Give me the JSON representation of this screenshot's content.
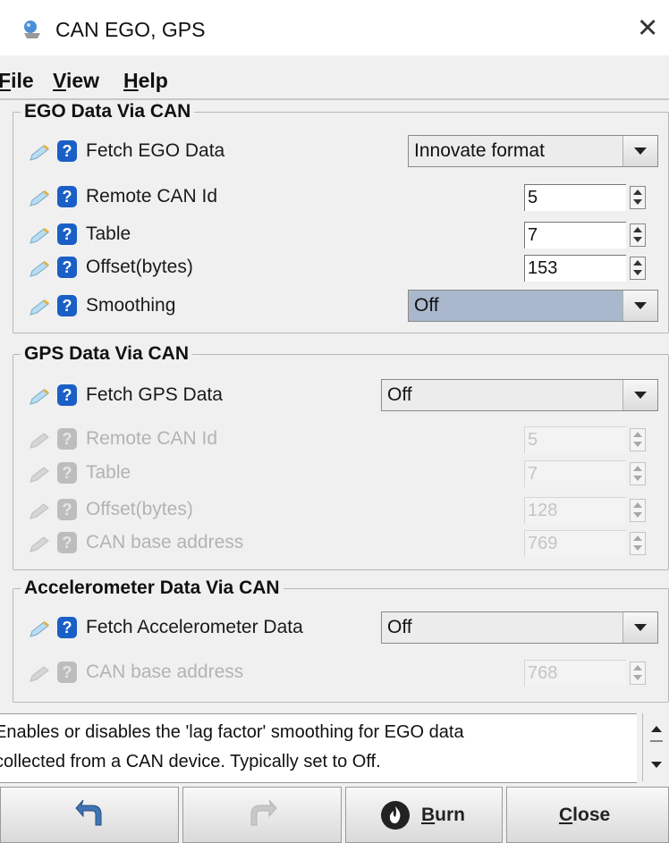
{
  "window": {
    "title": "CAN EGO, GPS"
  },
  "menu": {
    "file": {
      "first": "F",
      "rest": "ile"
    },
    "view": {
      "first": "V",
      "rest": "iew"
    },
    "help": {
      "first": "H",
      "rest": "elp"
    }
  },
  "ego_group": {
    "title": "EGO Data Via CAN",
    "fetch": {
      "label": "Fetch EGO Data",
      "value": "Innovate format"
    },
    "remote_can_id": {
      "label": "Remote CAN Id",
      "value": "5"
    },
    "table": {
      "label": "Table",
      "value": "7"
    },
    "offset": {
      "label": "Offset(bytes)",
      "value": "153"
    },
    "smoothing": {
      "label": "Smoothing",
      "value": "Off"
    }
  },
  "gps_group": {
    "title": "GPS Data Via CAN",
    "fetch": {
      "label": "Fetch GPS Data",
      "value": "Off"
    },
    "remote_can_id": {
      "label": "Remote CAN Id",
      "value": "5"
    },
    "table": {
      "label": "Table",
      "value": "7"
    },
    "offset": {
      "label": "Offset(bytes)",
      "value": "128"
    },
    "base_address": {
      "label": "CAN base address",
      "value": "769"
    }
  },
  "accel_group": {
    "title": "Accelerometer Data Via CAN",
    "fetch": {
      "label": "Fetch Accelerometer Data",
      "value": "Off"
    },
    "base_address": {
      "label": "CAN base address",
      "value": "768"
    }
  },
  "help_text": {
    "line1": "Enables or disables the 'lag factor' smoothing for EGO data",
    "line2": "collected from a CAN device. Typically set to Off."
  },
  "buttons": {
    "burn": {
      "first": "B",
      "rest": "urn"
    },
    "close": {
      "first": "C",
      "rest": "lose"
    }
  },
  "colors": {
    "help_icon": "#1a5fc6",
    "selected_combo": "#a9b8cc"
  }
}
